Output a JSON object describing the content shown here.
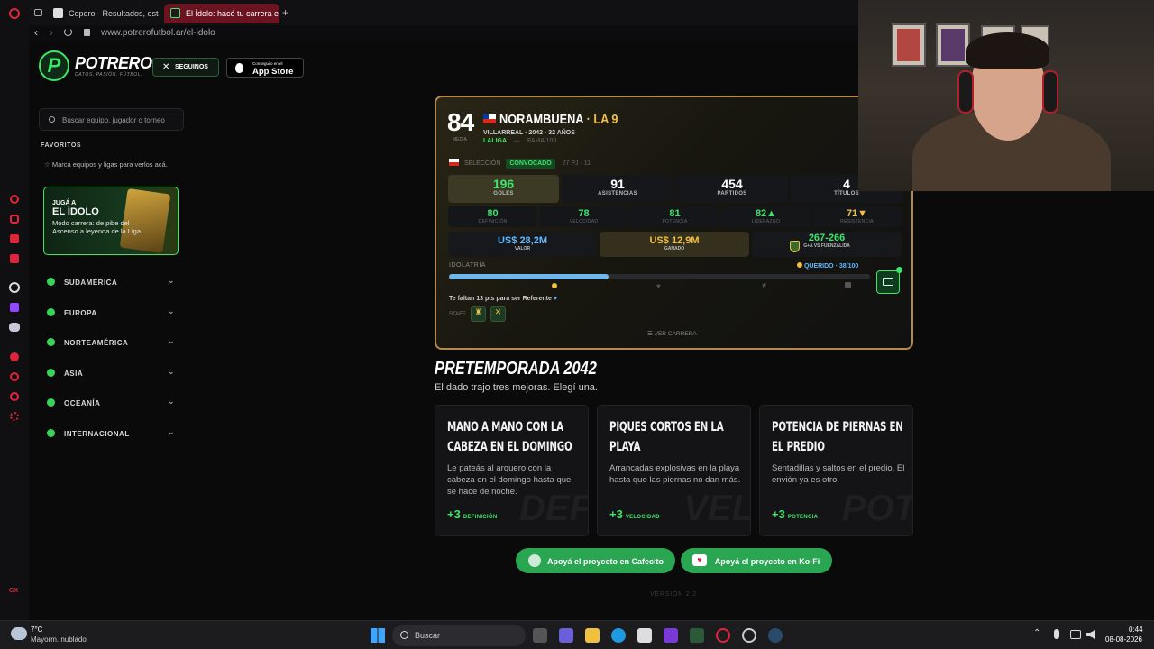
{
  "browser": {
    "tabs": [
      {
        "label": "Copero - Resultados, estad"
      },
      {
        "label": "El Ídolo: hacé tu carrera en"
      }
    ],
    "url": "www.potrerofutbol.ar/el-idolo"
  },
  "header": {
    "logo_text": "POTRERO",
    "logo_tagline": "DATOS. PASIÓN. FÚTBOL.",
    "follow_label": "SEGUINOS",
    "appstore_small": "Conseguilo en el",
    "appstore_big": "App Store"
  },
  "sidebar": {
    "search_placeholder": "Buscar equipo, jugador o torneo",
    "favorites_title": "FAVORITOS",
    "favorites_hint": "Marcá equipos y ligas para verlos acá.",
    "promo": {
      "kicker": "JUGÁ A",
      "title": "EL ÍDOLO",
      "text": "Modo carrera: de pibe del Ascenso a leyenda de la Liga"
    },
    "regions": [
      {
        "label": "SUDAMÉRICA"
      },
      {
        "label": "EUROPA"
      },
      {
        "label": "NORTEAMÉRICA"
      },
      {
        "label": "ASIA"
      },
      {
        "label": "OCEANÍA"
      },
      {
        "label": "INTERNACIONAL"
      }
    ]
  },
  "player": {
    "rating": "84",
    "rating_label": "MEDIA",
    "name": "NORAMBUENA",
    "number": "· LA 9",
    "club_line": "VILLARREAL · 2042 · 32 AÑOS",
    "league": "LALIGA",
    "fame": "FAMA 100",
    "selection_label": "SELECCIÓN",
    "selection_status": "CONVOCADO",
    "selection_stats": "27 PJ · 11",
    "stats": [
      {
        "value": "196",
        "key": "GOLES"
      },
      {
        "value": "91",
        "key": "ASISTENCIAS"
      },
      {
        "value": "454",
        "key": "PARTIDOS"
      },
      {
        "value": "4",
        "key": "TÍTULOS"
      }
    ],
    "attributes": [
      {
        "value": "80",
        "key": "DEFINICIÓN"
      },
      {
        "value": "78",
        "key": "VELOCIDAD"
      },
      {
        "value": "81",
        "key": "POTENCIA"
      },
      {
        "value": "82▲",
        "key": "LIDERAZGO"
      },
      {
        "value": "71▼",
        "key": "RESISTENCIA"
      }
    ],
    "money": [
      {
        "value": "US$ 28,2M",
        "key": "VALOR"
      },
      {
        "value": "US$ 12,9M",
        "key": "GANADO"
      }
    ],
    "rival": {
      "value": "267-266",
      "key": "G+A VS FUENZALIDA"
    },
    "idolatry_label": "IDOLATRÍA",
    "idolatry_status": "QUERIDO · 38/100",
    "idolatry_progress": 0.38,
    "referente_hint": "Te faltan 13 pts para ser Referente",
    "staff_label": "STAFF",
    "career_link": "VER CARRERA"
  },
  "preseason": {
    "title": "PRETEMPORADA 2042",
    "subtitle": "El dado trajo tres mejoras. Elegí una.",
    "options": [
      {
        "title": "MANO A MANO CON LA CABEZA EN EL DOMINGO",
        "desc": "Le pateás al arquero con la cabeza en el domingo hasta que se hace de noche.",
        "bonus": "+3",
        "attr": "DEFINICIÓN",
        "watermark": "DEF"
      },
      {
        "title": "PIQUES CORTOS EN LA PLAYA",
        "desc": "Arrancadas explosivas en la playa hasta que las piernas no dan más.",
        "bonus": "+3",
        "attr": "VELOCIDAD",
        "watermark": "VEL"
      },
      {
        "title": "POTENCIA DE PIERNAS EN EL PREDIO",
        "desc": "Sentadillas y saltos en el predio. El envión ya es otro.",
        "bonus": "+3",
        "attr": "POTENCIA",
        "watermark": "POT"
      }
    ]
  },
  "support": {
    "cafecito": "Apoyá el proyecto en Cafecito",
    "kofi": "Apoyá el proyecto en Ko-Fi",
    "version": "VERSIÓN 2.2"
  },
  "taskbar": {
    "weather_temp": "7°C",
    "weather_desc": "Mayorm. nublado",
    "search_label": "Buscar",
    "time": "0:44",
    "date": "08-08-2026"
  },
  "colors": {
    "accent_green": "#3ee56b",
    "card_border": "#b5894a",
    "gold": "#f0c040"
  }
}
